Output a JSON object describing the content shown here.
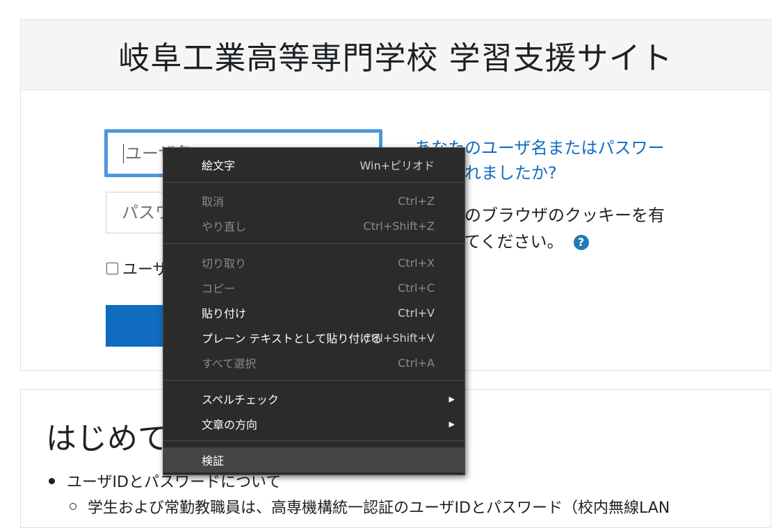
{
  "site": {
    "title": "岐阜工業高等専門学校 学習支援サイト"
  },
  "login": {
    "username_placeholder": "ユーザ名",
    "password_placeholder": "パスワード",
    "remember_label": "ユーザ名を記憶する",
    "forgot_link_line1": "あなたのユーザ名またはパスワー",
    "forgot_link_line2": "ドを忘れましたか?",
    "cookies_line1": "あなたのブラウザのクッキーを有",
    "cookies_line2": "効にしてください。",
    "help_icon": "?"
  },
  "intro": {
    "heading": "はじめての方へ",
    "bullet1": "ユーザIDとパスワードについて",
    "sub1": "学生および常勤教職員は、高専機構統一認証のユーザIDとパスワード（校内無線LAN"
  },
  "context_menu": {
    "items": [
      {
        "label": "絵文字",
        "shortcut": "Win+ピリオド",
        "enabled": true
      },
      {
        "label": "取消",
        "shortcut": "Ctrl+Z",
        "enabled": false
      },
      {
        "label": "やり直し",
        "shortcut": "Ctrl+Shift+Z",
        "enabled": false
      },
      {
        "label": "切り取り",
        "shortcut": "Ctrl+X",
        "enabled": false
      },
      {
        "label": "コピー",
        "shortcut": "Ctrl+C",
        "enabled": false
      },
      {
        "label": "貼り付け",
        "shortcut": "Ctrl+V",
        "enabled": true
      },
      {
        "label": "プレーン テキストとして貼り付ける",
        "shortcut": "Ctrl+Shift+V",
        "enabled": true
      },
      {
        "label": "すべて選択",
        "shortcut": "Ctrl+A",
        "enabled": false
      },
      {
        "label": "スペルチェック",
        "submenu": "▶",
        "enabled": true
      },
      {
        "label": "文章の方向",
        "submenu": "▶",
        "enabled": true
      },
      {
        "label": "検証",
        "enabled": true,
        "highlighted": true
      }
    ]
  }
}
